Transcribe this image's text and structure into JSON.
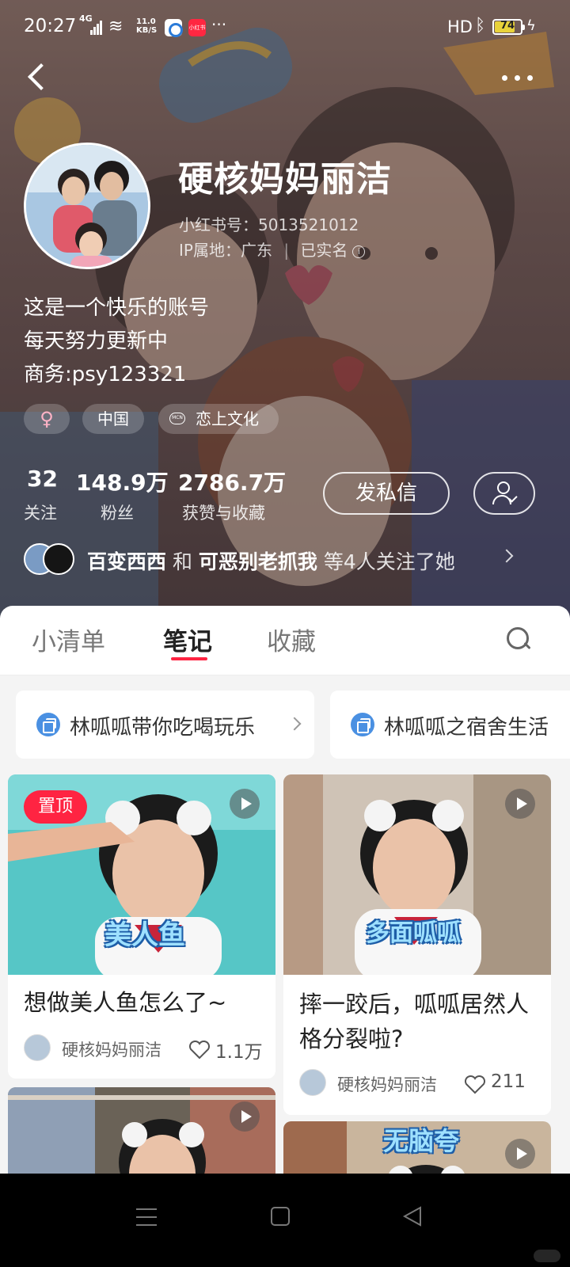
{
  "status_bar": {
    "time": "20:27",
    "network": "4G",
    "speed_top": "11.0",
    "speed_unit": "KB/S",
    "app2_label": "小红书",
    "more": "···",
    "hd": "HD",
    "battery": "74"
  },
  "profile": {
    "nickname": "硬核妈妈丽洁",
    "id_label": "小红书号：",
    "id_value": "5013521012",
    "ip_label": "IP属地：",
    "ip_value": "广东",
    "separator": "|",
    "verified": "已实名",
    "bio": [
      "这是一个快乐的账号",
      "每天努力更新中",
      "商务:psy123321"
    ],
    "tags": {
      "gender": "♀",
      "region": "中国",
      "mcn_icon": "MCN",
      "mcn": "恋上文化"
    },
    "stats": [
      {
        "value": "32",
        "label": "关注"
      },
      {
        "value": "148.9万",
        "label": "粉丝"
      },
      {
        "value": "2786.7万",
        "label": "获赞与收藏"
      }
    ],
    "message_button": "发私信",
    "mutual": {
      "user1": "百变西西",
      "conj": " 和 ",
      "user2": "可恶别老抓我",
      "suffix": " 等4人关注了她"
    }
  },
  "tabs": [
    {
      "label": "小清单",
      "active": false
    },
    {
      "label": "笔记",
      "active": true
    },
    {
      "label": "收藏",
      "active": false
    }
  ],
  "collections": [
    {
      "title": "林呱呱带你吃喝玩乐"
    },
    {
      "title": "林呱呱之宿舍生活"
    }
  ],
  "notes": [
    {
      "title": "想做美人鱼怎么了~",
      "author": "硬核妈妈丽洁",
      "likes": "1.1万",
      "pinned": "置顶",
      "cover_text": "美人鱼"
    },
    {
      "title": "摔一跤后，呱呱居然人格分裂啦?",
      "author": "硬核妈妈丽洁",
      "likes": "211",
      "cover_text": "多面呱呱"
    },
    {
      "title": "",
      "author": "",
      "likes": ""
    },
    {
      "title": "",
      "author": "",
      "likes": "",
      "cover_text": "无脑夸"
    }
  ],
  "colors": {
    "accent": "#ff2442",
    "header_bg": "#6f5955",
    "collection_icon": "#4a90e2"
  }
}
